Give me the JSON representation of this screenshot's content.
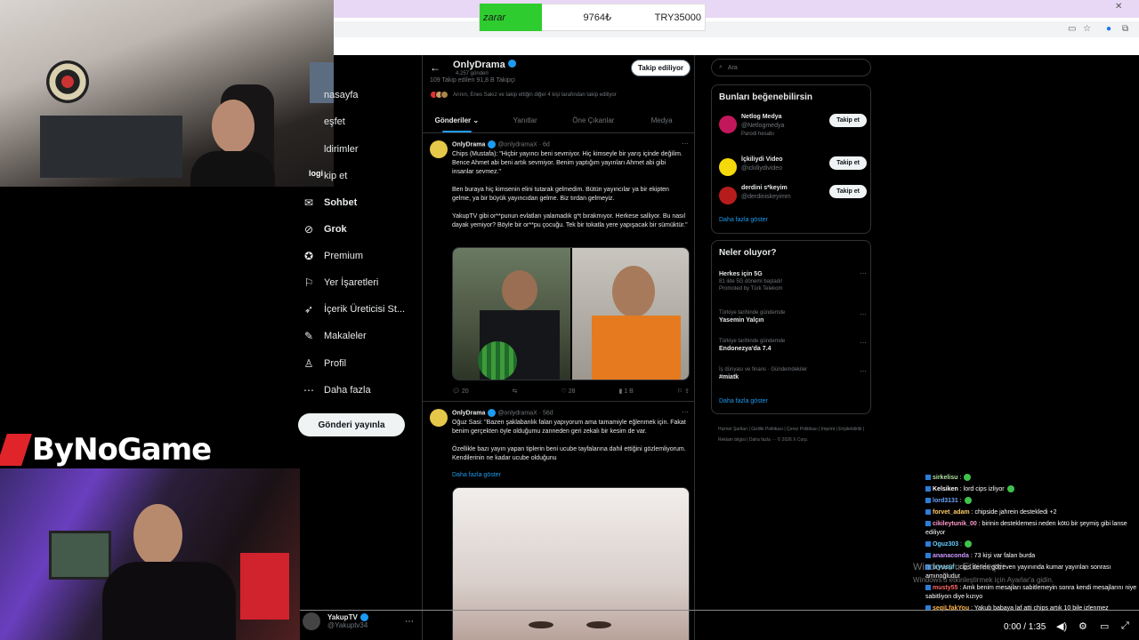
{
  "overlay": {
    "label": "zarar",
    "value1": "9764₺",
    "value2": "TRY35000"
  },
  "logo": {
    "text": "ByNoGame"
  },
  "nav": [
    {
      "label": "nasayfa",
      "icon": "home-icon",
      "glyph": ""
    },
    {
      "label": "eşfet",
      "icon": "explore-icon",
      "glyph": ""
    },
    {
      "label": "ldirimler",
      "icon": "bell-icon",
      "glyph": ""
    },
    {
      "label": "kip et",
      "icon": "follow-icon",
      "glyph": ""
    },
    {
      "label": "Sohbet",
      "icon": "chat-icon",
      "glyph": "✉"
    },
    {
      "label": "Grok",
      "icon": "grok-icon",
      "glyph": "⊘"
    },
    {
      "label": "Premium",
      "icon": "premium-icon",
      "glyph": "✪"
    },
    {
      "label": "Yer İşaretleri",
      "icon": "bookmark-icon",
      "glyph": "⚐"
    },
    {
      "label": "İçerik Üreticisi St...",
      "icon": "rocket-icon",
      "glyph": "➶"
    },
    {
      "label": "Makaleler",
      "icon": "article-icon",
      "glyph": "✎"
    },
    {
      "label": "Profil",
      "icon": "profile-icon",
      "glyph": "♙"
    },
    {
      "label": "Daha fazla",
      "icon": "more-icon",
      "glyph": "⋯"
    }
  ],
  "nav_logo_text": "logi",
  "post_button": "Gönderi yayınla",
  "account": {
    "name": "YakupTV",
    "handle": "@Yakuptv34",
    "more": "⋯"
  },
  "profile": {
    "name": "OnlyDrama",
    "posts": "4.257 gönderi",
    "follow_button": "Takip ediliyor",
    "stats": "109 Takip edilen   91,8 B Takipçi",
    "followers_note": "Arının, Enes Sakız ve takip ettiğin diğer 4 kişi tarafından takip ediliyor"
  },
  "tabs": [
    {
      "label": "Gönderiler ⌄",
      "active": true
    },
    {
      "label": "Yanıtlar",
      "active": false
    },
    {
      "label": "Öne Çıkanlar",
      "active": false
    },
    {
      "label": "Medya",
      "active": false
    }
  ],
  "tweets": [
    {
      "name": "OnlyDrama",
      "handle": "@onlydramaX · 6d",
      "text": "Chips (Mustafa): \"Hiçbir yayıncı beni sevmiyor. Hiç kimseyle bir yarış içinde değilim. Bence Ahmet abi beni artık sevmiyor. Benim yaptığım yayınları Ahmet abi gibi insanlar sevmez.\"\n\nBen buraya hiç kimsenin elini tutarak gelmedim. Bütün yayıncılar ya bir ekipten gelme, ya bir büyük yayıncıdan gelme. Biz tırdan gelmeyiz.\n\nYakupTV gibi or**punun evlatları yalamadık g*t bırakmıyor. Herkese salliyor. Bu nasıl dayak yemiyor? Böyle bir or**pu çocuğu. Tek bir tokatla yere yapışacak bir sümüktür.\"",
      "actions": {
        "reply": "20",
        "retweet": "",
        "like": "28",
        "views": "1 B"
      }
    },
    {
      "name": "OnlyDrama",
      "handle": "@onlydramaX · 56d",
      "text": "Oğuz Sasi: \"Bazen şaklabanlık falan yapıyorum ama tamamiyle eğlenmek için. Fakat benim gerçekten öyle olduğumu zanneden geri zekalı bir kesim de var.\n\nÖzellikle bazı yayın yapan tiplerin beni ucube tayfalarına dahil ettiğini gözlemliyorum. Kendilerinin ne kadar ucube olduğunu",
      "show_more": "Daha fazla göster"
    }
  ],
  "search": {
    "placeholder": "Ara"
  },
  "suggestions": {
    "title": "Bunları beğenebilirsin",
    "items": [
      {
        "name": "Netlog Medya",
        "handle": "@Netlogmedya",
        "extra": "Parodi hesabı",
        "button": "Takip et",
        "color": "#c2185b"
      },
      {
        "name": "İçkiliydi Video",
        "handle": "@ickiliydivideo",
        "extra": "",
        "button": "Takip et",
        "color": "#f5d90a"
      },
      {
        "name": "derdini s*keyim",
        "handle": "@derdiniskeyimm",
        "extra": "",
        "button": "Takip et",
        "color": "#b71c1c"
      }
    ],
    "show_more": "Daha fazla göster"
  },
  "trends": {
    "title": "Neler oluyor?",
    "items": [
      {
        "context": "",
        "title": "Herkes için 5G",
        "sub": "81 ilde 5G dönemi başladı!",
        "sub2": "Promoted by Türk Telekom"
      },
      {
        "context": "Türkiye tarihinde gündemde",
        "title": "Yasemin Yalçın",
        "sub": "",
        "sub2": ""
      },
      {
        "context": "Türkiye tarihinde gündemde",
        "title": "Endonezya'da 7.4",
        "sub": "",
        "sub2": ""
      },
      {
        "context": "İş dünyası ve finans · Gündemdekiler",
        "title": "#miatk",
        "sub": "",
        "sub2": ""
      }
    ],
    "show_more": "Daha fazla göster"
  },
  "footer": "Hizmet Şartları  |  Gizlilik Politikası  |  Çerez Politikası  |  Imprint  |  Erişilebilirlik  |  Reklam bilgisi  |  Daha fazla ···  © 2026 X Corp.",
  "chat": [
    {
      "user": "sirkelisu",
      "msg": ":",
      "color": "#b0e0a0",
      "emote": true
    },
    {
      "user": "Kelsiken",
      "msg": ": lord cips izliyor",
      "color": "#ffffff",
      "emote": true
    },
    {
      "user": "lord3131",
      "msg": ":",
      "color": "#6fa8ff",
      "emote": true
    },
    {
      "user": "forvet_adam",
      "msg": ": chipside jahrein destekledi +2",
      "color": "#ffcc66",
      "emote": false
    },
    {
      "user": "cikileytunik_00",
      "msg": ": birinin desteklemesi neden kötü bir şeymiş gibi lanse ediliyor",
      "color": "#ff99cc",
      "emote": false
    },
    {
      "user": "Oguz303",
      "msg": ":",
      "color": "#66ccff",
      "emote": true
    },
    {
      "user": "ananaconda",
      "msg": ": 73 kişi var falan burda",
      "color": "#cc99ff",
      "emote": false
    },
    {
      "user": "ixyusuf",
      "msg": ": cips denen götreven yayınında kumar yayınları sonrası amınoğludur",
      "color": "#66d9ff",
      "emote": false
    },
    {
      "user": "musty55",
      "msg": ": Amk benim mesajları sabitlemeyin sonra kendi mesajlarını niye sabitliyon diye kızıyo",
      "color": "#ff6666",
      "emote": false
    },
    {
      "user": "seqiLfakYou",
      "msg": ": Yakub babaya laf atti chips artık 10 bile izlenmez",
      "color": "#ffb347",
      "emote": false
    }
  ],
  "windows": {
    "line1": "Windows'u Etkinleştir",
    "line2": "Windows'u etkinleştirmek için Ayarlar'a gidin."
  },
  "player": {
    "time": "0:00 / 1:35"
  }
}
